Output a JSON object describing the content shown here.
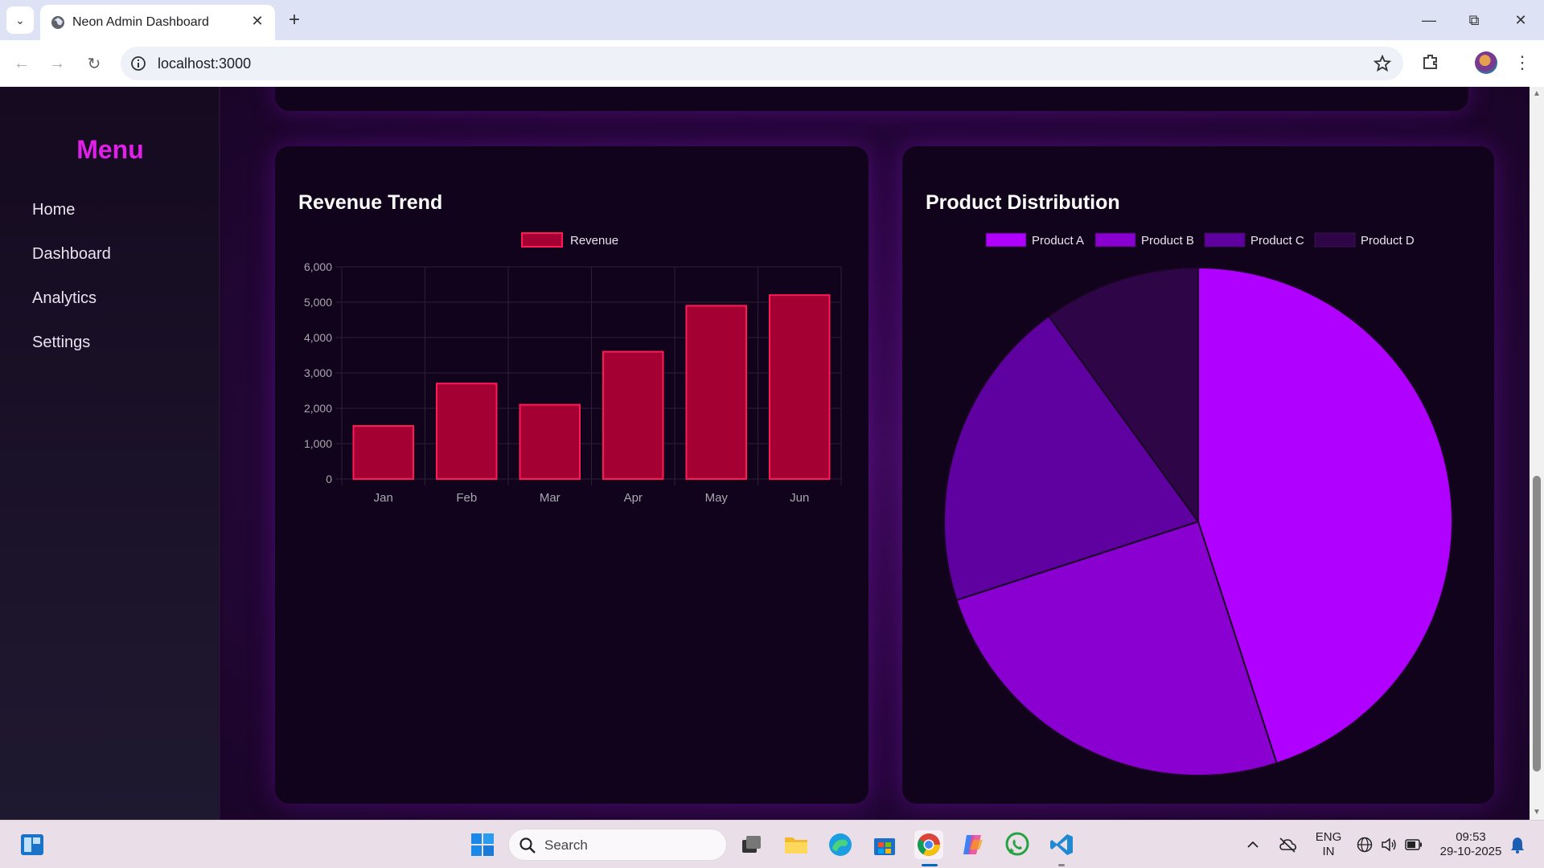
{
  "browser": {
    "tab_title": "Neon Admin Dashboard",
    "url": "localhost:3000"
  },
  "sidebar": {
    "title": "Menu",
    "items": [
      {
        "label": "Home"
      },
      {
        "label": "Dashboard"
      },
      {
        "label": "Analytics"
      },
      {
        "label": "Settings"
      }
    ]
  },
  "revenue_card": {
    "title": "Revenue Trend"
  },
  "product_card": {
    "title": "Product Distribution"
  },
  "chart_data": [
    {
      "type": "bar",
      "title": "Revenue Trend",
      "categories": [
        "Jan",
        "Feb",
        "Mar",
        "Apr",
        "May",
        "Jun"
      ],
      "series": [
        {
          "name": "Revenue",
          "values": [
            1500,
            2700,
            2100,
            3600,
            4900,
            5200
          ],
          "color": "#a50034",
          "border": "#ff1a55"
        }
      ],
      "ylim": [
        0,
        6000
      ],
      "yticks": [
        "0",
        "1,000",
        "2,000",
        "3,000",
        "4,000",
        "5,000",
        "6,000"
      ],
      "grid": true,
      "legend": "top"
    },
    {
      "type": "pie",
      "title": "Product Distribution",
      "labels": [
        "Product A",
        "Product B",
        "Product C",
        "Product D"
      ],
      "values": [
        45,
        25,
        20,
        10
      ],
      "colors": [
        "#b000ff",
        "#8a00d0",
        "#5f00a0",
        "#2e0648"
      ],
      "legend": "top"
    }
  ],
  "taskbar": {
    "search_placeholder": "Search",
    "lang_top": "ENG",
    "lang_bottom": "IN",
    "time": "09:53",
    "date": "29-10-2025"
  }
}
